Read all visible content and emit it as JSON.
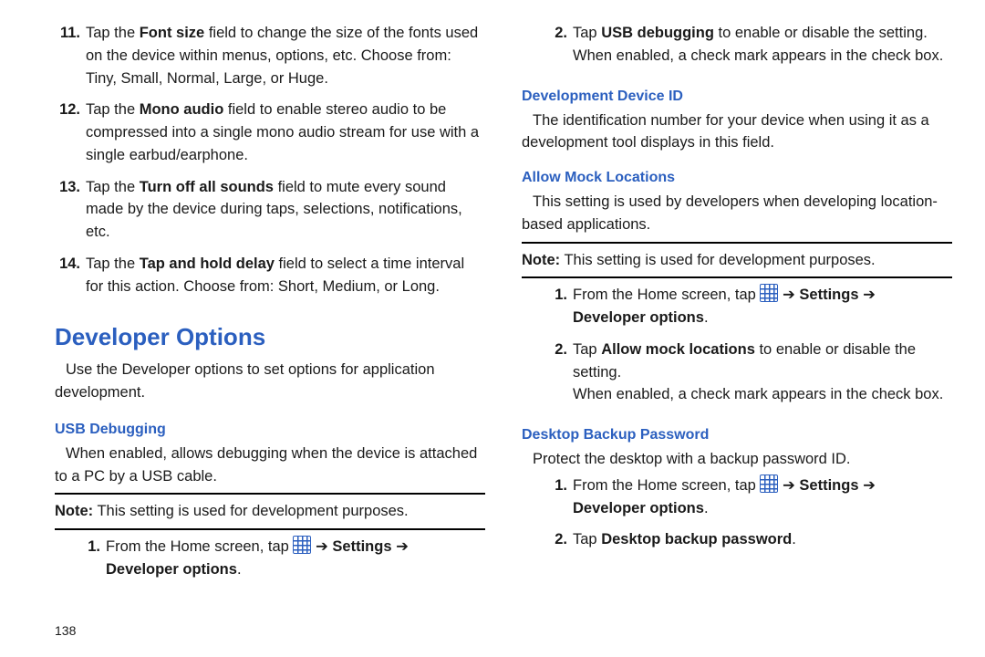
{
  "page_number": "138",
  "arrow": "➔",
  "leftCol": {
    "topSteps": [
      {
        "n": "11.",
        "pre": "Tap the ",
        "bold": "Font size",
        "post": " field to change the size of the fonts used on the device within menus, options, etc. Choose from: Tiny, Small, Normal, Large, or Huge."
      },
      {
        "n": "12.",
        "pre": "Tap the ",
        "bold": "Mono audio",
        "post": " field to enable stereo audio to be compressed into a single mono audio stream for use with a single earbud/earphone."
      },
      {
        "n": "13.",
        "pre": "Tap the ",
        "bold": "Turn off all sounds",
        "post": " field to mute every sound made by the device during taps, selections, notifications, etc."
      },
      {
        "n": "14.",
        "pre": "Tap the ",
        "bold": "Tap and hold delay",
        "post": " field to select a time interval for this action. Choose from: Short, Medium, or Long."
      }
    ],
    "devOptions": {
      "heading": "Developer Options",
      "intro": "Use the Developer options to set options for application development."
    },
    "usb": {
      "heading": "USB Debugging",
      "body": "When enabled, allows debugging when the device is attached to a PC by a USB cable.",
      "noteLabel": "Note:",
      "noteText": " This setting is used for development purposes.",
      "steps": [
        {
          "n": "1.",
          "prefix": "From the Home screen, tap ",
          "arrowText": " ➔ ",
          "bold1": "Settings",
          "arrow2": " ➔ ",
          "bold2": "Developer options",
          "end": "."
        }
      ]
    }
  },
  "rightCol": {
    "usbStep2": {
      "n": "2.",
      "pre": "Tap ",
      "bold": "USB debugging",
      "post": " to enable or disable the setting. When enabled, a check mark appears in the check box."
    },
    "devId": {
      "heading": "Development Device ID",
      "body": "The identification number for your device when using it as a development tool displays in this field."
    },
    "mock": {
      "heading": "Allow Mock Locations",
      "body": "This setting is used by developers when developing location-based applications.",
      "noteLabel": "Note:",
      "noteText": " This setting is used for development purposes.",
      "steps": [
        {
          "n": "1.",
          "prefix": "From the Home screen, tap ",
          "arrowText": " ➔ ",
          "bold1": "Settings",
          "arrow2": " ➔ ",
          "bold2": "Developer options",
          "end": "."
        },
        {
          "n": "2.",
          "pre": "Tap ",
          "bold": "Allow mock locations",
          "post": " to enable or disable the setting.",
          "extra": "When enabled, a check mark appears in the check box."
        }
      ]
    },
    "backup": {
      "heading": "Desktop Backup Password",
      "body": "Protect the desktop with a backup password ID.",
      "steps": [
        {
          "n": "1.",
          "prefix": "From the Home screen, tap ",
          "arrowText": " ➔ ",
          "bold1": "Settings",
          "arrow2": " ➔ ",
          "bold2": "Developer options",
          "end": "."
        },
        {
          "n": "2.",
          "pre": "Tap ",
          "bold": "Desktop backup password",
          "post": "."
        }
      ]
    }
  }
}
